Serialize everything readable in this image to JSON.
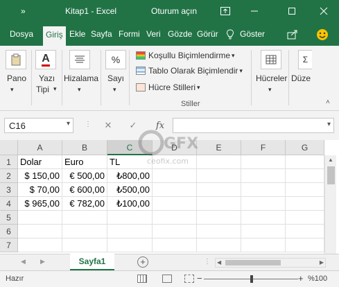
{
  "titlebar": {
    "autosave_glyph": "»",
    "doc_title": "Kitap1 - Excel",
    "signin": "Oturum açın",
    "colors": {
      "bg": "#217346",
      "fg": "#ffffff"
    }
  },
  "tabs": [
    {
      "label": "Dosya",
      "active": false
    },
    {
      "label": "Giriş",
      "active": true
    },
    {
      "label": "Ekle",
      "active": false
    },
    {
      "label": "Sayfa",
      "active": false
    },
    {
      "label": "Formi",
      "active": false
    },
    {
      "label": "Veri",
      "active": false
    },
    {
      "label": "Gözde",
      "active": false
    },
    {
      "label": "Görür",
      "active": false
    },
    {
      "label": "Göster",
      "active": false
    }
  ],
  "ribbon": {
    "pano": "Pano",
    "yazi_tipi_1": "Yazı",
    "yazi_tipi_2": "Tipi",
    "hizalama": "Hizalama",
    "sayi": "Sayı",
    "kosullu": "Koşullu Biçimlendirme",
    "tablo": "Tablo Olarak Biçimlendir",
    "hucre_stilleri": "Hücre Stilleri",
    "group_stiller": "Stiller",
    "hucreler": "Hücreler",
    "duzen": "Düze",
    "percent_glyph": "%",
    "font_glyph": "A"
  },
  "formula_bar": {
    "name_box": "C16",
    "cancel": "✕",
    "enter": "✓",
    "fx": "fx",
    "formula": ""
  },
  "grid": {
    "columns": [
      "A",
      "B",
      "C",
      "D",
      "E",
      "F",
      "G"
    ],
    "selected_column": "C",
    "rows": [
      "1",
      "2",
      "3",
      "4",
      "5",
      "6",
      "7"
    ],
    "cells": [
      [
        "Dolar",
        "Euro",
        "TL"
      ],
      [
        "$ 150,00",
        "€ 500,00",
        "₺800,00"
      ],
      [
        "$ 70,00",
        "€ 600,00",
        "₺500,00"
      ],
      [
        "$ 965,00",
        "€ 782,00",
        "₺100,00"
      ]
    ]
  },
  "sheets": {
    "active": "Sayfa1"
  },
  "status": {
    "ready": "Hazır",
    "zoom": "%100"
  },
  "watermark": {
    "logo": "GFX",
    "site": "ceofix.com"
  }
}
